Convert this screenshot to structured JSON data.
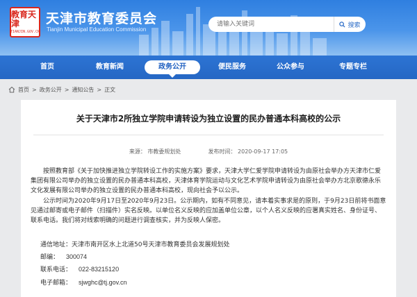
{
  "header": {
    "logo_text": "教育天津",
    "logo_sub": "TIANJIN.GOV.CN",
    "title": "天津市教育委员会",
    "subtitle": "Tianjin Municipal Education Commission",
    "search_placeholder": "请输入关键词",
    "search_button": "搜索"
  },
  "nav": {
    "items": [
      {
        "label": "首页"
      },
      {
        "label": "教育新闻"
      },
      {
        "label": "政务公开"
      },
      {
        "label": "便民服务"
      },
      {
        "label": "公众参与"
      },
      {
        "label": "专题专栏"
      }
    ],
    "active_index": 2
  },
  "breadcrumb": {
    "items": [
      "首页",
      "政务公开",
      "通知公告",
      "正文"
    ],
    "separator": ">"
  },
  "article": {
    "title": "关于天津市2所独立学院申请转设为独立设置的民办普通本科高校的公示",
    "source": "来源： 市教委规划处",
    "date": "发布时间： 2020-09-17 17:05",
    "paragraphs": [
      "按照教育部《关于加快推进独立学院转设工作的实施方案》要求，天津大学仁爱学院申请转设为由原社会举办方天津市仁爱集团有限公司举办的独立设置的民办普通本科高校，天津体育学院运动与文化艺术学院申请转设为由原社会举办方北京歌德永乐文化发展有限公司举办的独立设置的民办普通本科高校，现向社会予以公示。",
      "公示时间为2020年9月17日至2020年9月23日。公示期内，如有不同意见，请本着实事求是的原则，于9月23日前将书面意见通过邮寄或电子邮件（扫描件）实名反映。以单位名义反映的应加盖单位公章，以个人名义反映的应署真实姓名、身份证号、联系电话。我们将对线索明确的问题进行调查核实，并为反映人保密。"
    ],
    "contact": [
      {
        "label": "通信地址：",
        "value": "天津市南开区水上北道50号天津市教育委员会发展规划处"
      },
      {
        "label": "邮编：",
        "value": "300074"
      },
      {
        "label": "联系电话：",
        "value": "022-83215120"
      },
      {
        "label": "电子邮箱：",
        "value": "sjwghc@tj.gov.cn"
      }
    ]
  },
  "colors": {
    "brand_blue": "#2567c4",
    "logo_red": "#d9261c"
  }
}
